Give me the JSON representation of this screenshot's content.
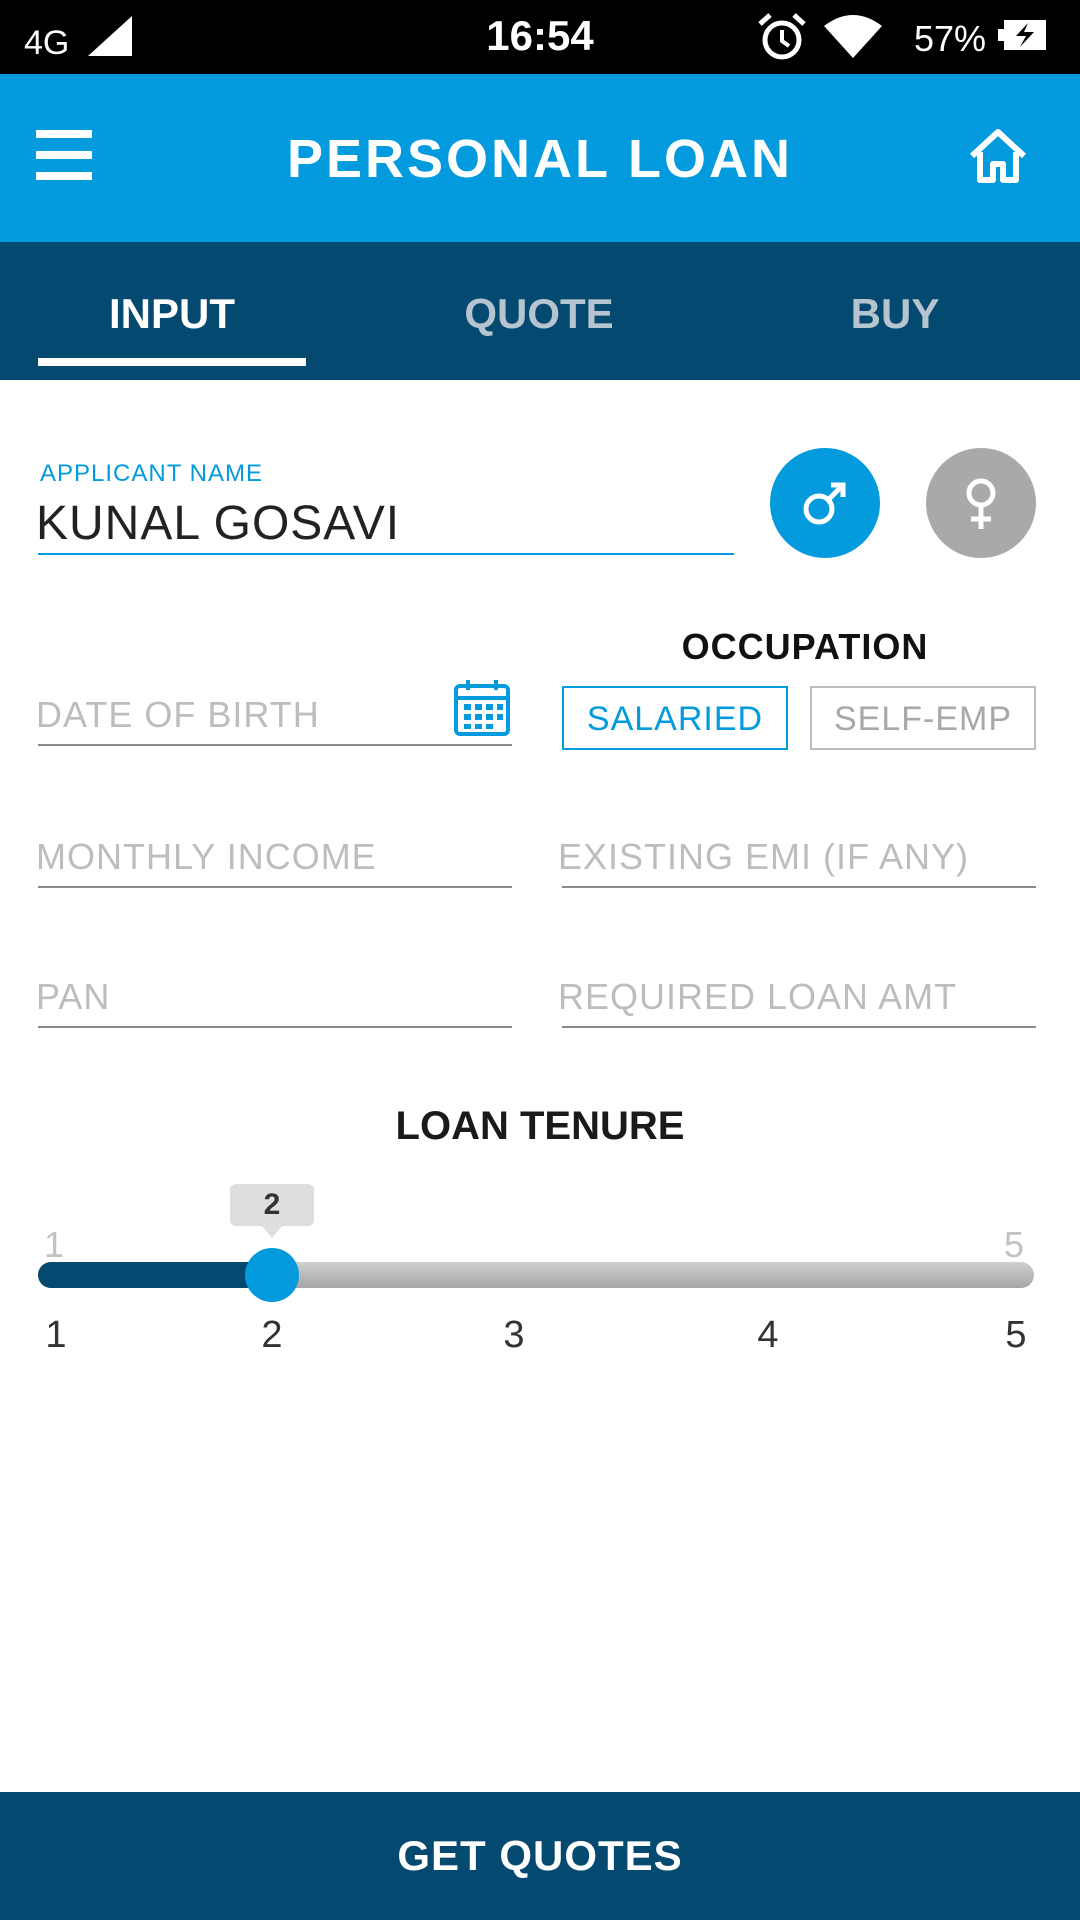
{
  "status_bar": {
    "network": "4G",
    "time": "16:54",
    "battery": "57%"
  },
  "app_bar": {
    "title": "PERSONAL LOAN",
    "menu_icon": "hamburger-menu-icon",
    "home_icon": "home-icon"
  },
  "tabs": [
    {
      "label": "INPUT",
      "active": true
    },
    {
      "label": "QUOTE",
      "active": false
    },
    {
      "label": "BUY",
      "active": false
    }
  ],
  "form": {
    "applicant_name": {
      "label": "APPLICANT NAME",
      "value": "KUNAL GOSAVI"
    },
    "gender": {
      "options": [
        "male",
        "female"
      ],
      "selected": "male"
    },
    "date_of_birth": {
      "placeholder": "DATE OF BIRTH",
      "value": ""
    },
    "occupation": {
      "title": "OCCUPATION",
      "options": [
        "SALARIED",
        "SELF-EMP"
      ],
      "selected": "SALARIED"
    },
    "monthly_income": {
      "placeholder": "MONTHLY INCOME",
      "value": ""
    },
    "existing_emi": {
      "placeholder": "EXISTING EMI (IF ANY)",
      "value": ""
    },
    "pan": {
      "placeholder": "PAN",
      "value": ""
    },
    "required_loan_amt": {
      "placeholder": "REQUIRED LOAN AMT",
      "value": ""
    }
  },
  "loan_tenure": {
    "title": "LOAN TENURE",
    "min": 1,
    "max": 5,
    "min_label": "1",
    "max_label": "5",
    "value": 2,
    "value_label": "2",
    "ticks": [
      "1",
      "2",
      "3",
      "4",
      "5"
    ]
  },
  "colors": {
    "primary": "#049ade",
    "dark": "#044970",
    "inactive_gender": "#a9a9a9"
  },
  "actions": {
    "get_quotes": "GET QUOTES"
  }
}
